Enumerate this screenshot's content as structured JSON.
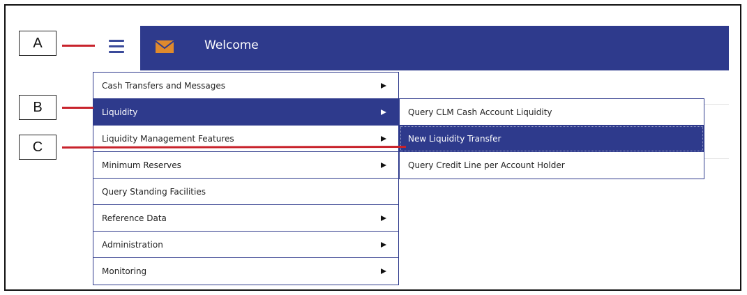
{
  "callouts": [
    "A",
    "B",
    "C"
  ],
  "header": {
    "title": "Welcome",
    "icon": "envelope-icon",
    "color": "#2e3a8c",
    "icon_color": "#e08a2c"
  },
  "menu": {
    "items": [
      {
        "label": "Cash Transfers and Messages",
        "has_submenu": true
      },
      {
        "label": "Liquidity",
        "has_submenu": true,
        "active": true
      },
      {
        "label": "Liquidity Management Features",
        "has_submenu": true
      },
      {
        "label": "Minimum Reserves",
        "has_submenu": true
      },
      {
        "label": "Query Standing Facilities",
        "has_submenu": false
      },
      {
        "label": "Reference Data",
        "has_submenu": true
      },
      {
        "label": "Administration",
        "has_submenu": true
      },
      {
        "label": "Monitoring",
        "has_submenu": true
      }
    ]
  },
  "submenu": {
    "items": [
      {
        "label": "Query CLM Cash Account Liquidity"
      },
      {
        "label": "New Liquidity Transfer",
        "active": true
      },
      {
        "label": "Query Credit Line per Account Holder"
      }
    ]
  },
  "accent_color": "#c8232c"
}
